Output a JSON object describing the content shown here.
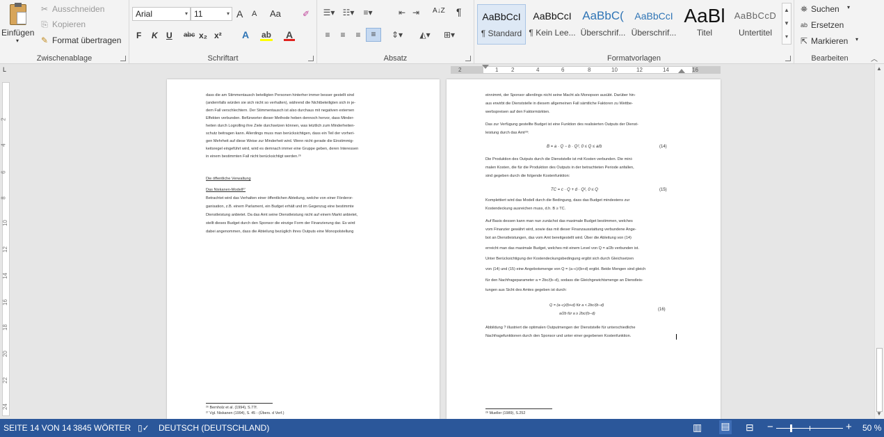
{
  "clipboard": {
    "paste": "Einfügen",
    "cut": "Ausschneiden",
    "copy": "Kopieren",
    "format_painter": "Format übertragen",
    "group": "Zwischenablage"
  },
  "font": {
    "name": "Arial",
    "size": "11",
    "bold": "F",
    "italic": "K",
    "underline": "U",
    "strike": "abc",
    "sub": "x₂",
    "sup": "x²",
    "grow": "A",
    "shrink": "A",
    "case": "Aa",
    "group": "Schriftart"
  },
  "paragraph": {
    "sort": "A↓Z",
    "pilcrow": "¶",
    "group": "Absatz"
  },
  "styles": {
    "items": [
      {
        "preview": "AaBbCcI",
        "name": "¶ Standard"
      },
      {
        "preview": "AaBbCcI",
        "name": "¶ Kein Lee..."
      },
      {
        "preview": "AaBbC(",
        "name": "Überschrif..."
      },
      {
        "preview": "AaBbCcI",
        "name": "Überschrif..."
      },
      {
        "preview": "AaBl",
        "name": "Titel"
      },
      {
        "preview": "AaBbCcD",
        "name": "Untertitel"
      }
    ],
    "group": "Formatvorlagen"
  },
  "editing": {
    "find": "Suchen",
    "replace": "Ersetzen",
    "select": "Markieren",
    "group": "Bearbeiten"
  },
  "ruler": {
    "marks": [
      "2",
      "1",
      "2",
      "4",
      "6",
      "8",
      "10",
      "12",
      "14",
      "16"
    ]
  },
  "vruler": {
    "marks": [
      "2",
      "4",
      "6",
      "8",
      "10",
      "12",
      "14",
      "16",
      "18",
      "20",
      "22",
      "24"
    ]
  },
  "page_left": {
    "lines": [
      "dass die am Stimmentausch beteiligten Personen hinterher immer besser gestellt sind",
      "(andernfalls würden sie sich nicht so verhalten), während die Nichtbeteiligten sich in je-",
      "dem Fall verschlechtern. Der Stimmentausch ist also durchaus mit negativen externen",
      "Effekten verbunden. Befürworter dieser Methode heben dennoch hervor, dass Minder-",
      "heiten durch Logrolling ihre Ziele durchsetzen können, was letztlich zum Minderheiten-",
      "schutz beitragen kann. Allerdings muss man berücksichtigen, dass ein Teil der vorheri-",
      "gen Mehrheit auf diese Weise zur Minderheit wird. Wenn nicht gerade die Einstimmig-",
      "keitsregel eingeführt wird, wird es demnach immer eine Gruppe geben, deren Interessen",
      "in einem bestimmten Fall nicht berücksichtigt werden.²⁶"
    ],
    "heading1": "Die öffentliche Verwaltung",
    "heading2": "Das Niskanen-Modell²⁷",
    "lines2": [
      "Betrachtet wird das Verhalten einer öffentlichen Abteilung, welche von einer Förderor-",
      "ganisation, z.B. einem Parlament, ein Budget erhält und im Gegenzug eine bestimmte",
      "Dienstleistung anbietet. Da das Amt seine Dienstleistung nicht auf einem Markt anbietet,",
      "stellt dieses Budget durch den Sponsor die einzige Form der Finanzierung dar. Es wird",
      "dabei angenommen, dass die Abteilung bezüglich ihres Outputs eine Monopolstellung"
    ],
    "footnotes": [
      "²⁶ Bernholz et al. (1994), S.77f.",
      "²⁷ Vgl. Niskanen (1994), S. 45 -    (Übers. d Verf.)"
    ]
  },
  "page_right": {
    "lines": [
      "einnimmt, der Sponsor allerdings nicht seine Macht als Monopson ausübt. Darüber hin-",
      "aus erwirbt die Dienststelle in diesem allgemeinen Fall sämtliche Faktoren zu Wettbe-",
      "werbspreisen auf den Faktormärkten."
    ],
    "p2": [
      "Das zur Verfügung gestellte Budget ist eine Funktion des realisierten Outputs der Dienst-",
      "leistung durch das Amt²⁸:"
    ],
    "f14": "B = a · Q − b · Q²,    0 ≤ Q ≤ a/b",
    "n14": "(14)",
    "p3": [
      "Die Produktion des Outputs durch die Dienststelle ist mit Kosten verbunden. Die mini-",
      "malen Kosten, die für die Produktion des Outputs in der betrachteten Periode anfallen,",
      "sind gegeben durch die folgende Kostenfunktion:"
    ],
    "f15": "TC = c · Q + d · Q²,    0 ≤ Q",
    "n15": "(15)",
    "p4": [
      "Komplettiert wird das Modell durch die Bedingung, dass das Budget mindestens zur",
      "Kostendeckung ausreichen muss, d.h. B ≥ TC."
    ],
    "p5": [
      "Auf Basis dessen kann man nun zunächst das maximale Budget bestimmen, welches",
      "vom Finanzier gewährt wird, sowie das mit dieser Finanzausstattung verbundene Ange-",
      "bot an Dienstleistungen, das vom Amt bereitgestellt wird. Über die Ableitung von (14)",
      "erreicht man das maximale Budget, welches mit einem Level von Q = a/2b verbunden ist.",
      "Unter Berücksichtigung der Kostendeckungsbedingung ergibt sich durch Gleichsetzen",
      "von (14) und (15) eine Angebotsmenge von Q = (a−c)/(b+d) ergibt. Beide Mengen sind gleich",
      "für den Nachfrageparameter a = 2bc/(b−d), sodass die Gleichgewichtsmenge an Dienstleis-",
      "tungen aus Sicht des Amtes gegeben ist durch:"
    ],
    "f16a": "Q = (a−c)/(b+d)   für a < 2bc/(b−d)",
    "f16b": "a/2b   für a ≥ 2bc/(b−d)",
    "n16": "(16)",
    "p6": [
      "Abbildung ? illustriert die optimalen Outputmengen der Dienststelle für unterschiedliche",
      "Nachfragefunktionen durch den Sponsor und unter einer gegebenen Kostenfunktion."
    ],
    "footnotes": [
      "²⁸ Mueller (1989), S.252"
    ]
  },
  "status": {
    "page": "SEITE 14 VON 14",
    "words": "3845 WÖRTER",
    "lang": "DEUTSCH (DEUTSCHLAND)",
    "zoom": "50 %",
    "zoom_level": 0.5
  },
  "colors": {
    "status_bg": "#2b579a",
    "ribbon_bg": "#f3f3f3"
  }
}
